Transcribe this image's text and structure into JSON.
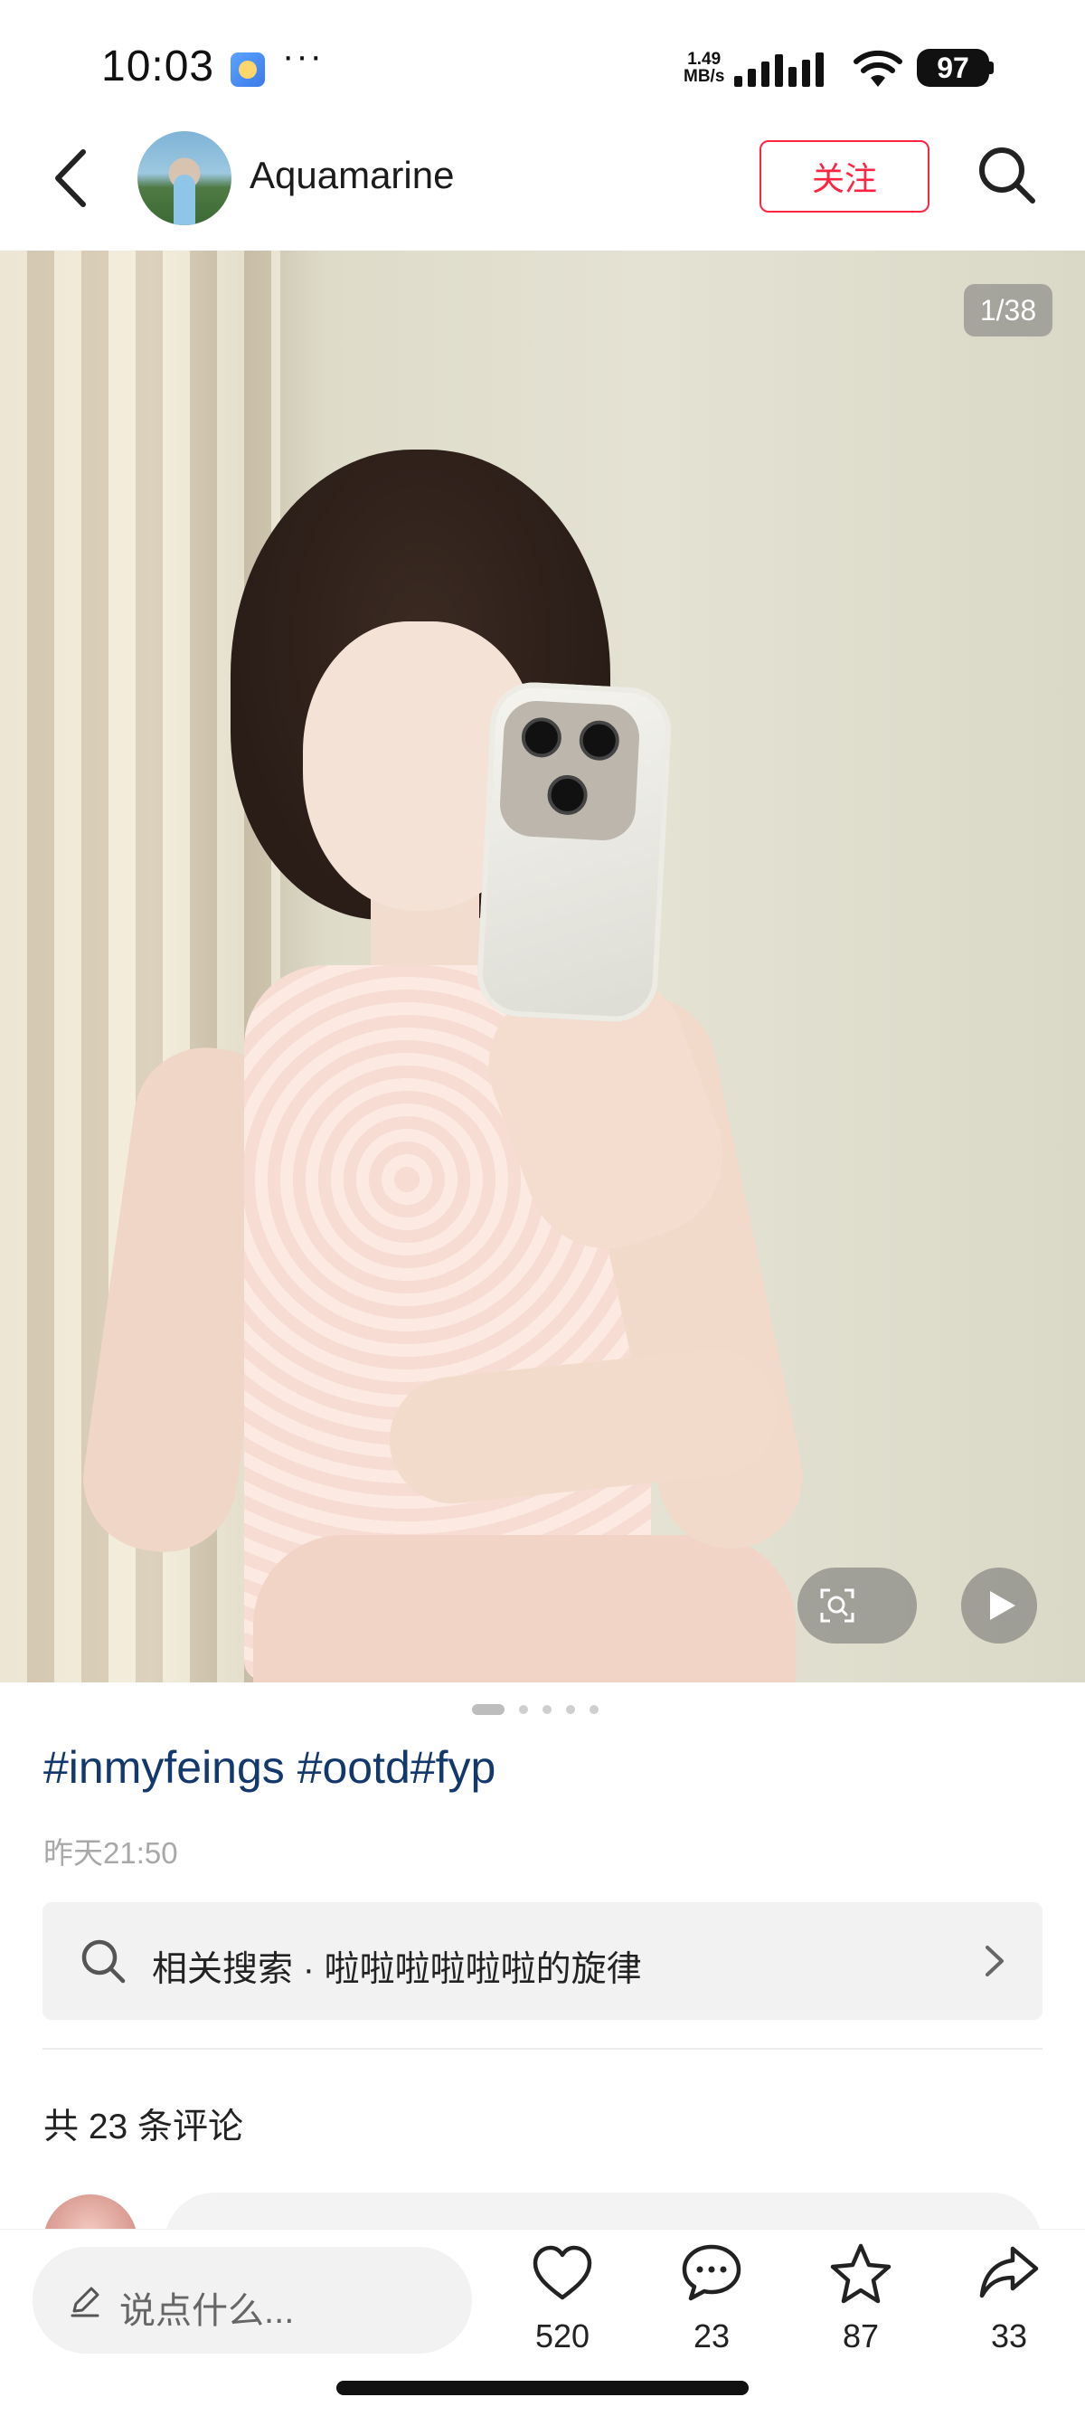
{
  "status_bar": {
    "time": "10:03",
    "dots": "···",
    "net_speed_value": "1.49",
    "net_speed_unit": "MB/s",
    "battery": "97",
    "icons": [
      "app-notification-icon",
      "signal-icon",
      "wifi-icon",
      "battery-icon"
    ]
  },
  "nav": {
    "username": "Aquamarine",
    "follow_label": "关注",
    "icons": [
      "back-icon",
      "search-icon"
    ]
  },
  "media": {
    "counter": "1/38",
    "icons": [
      "image-search-icon",
      "play-icon"
    ],
    "page_dots_total": 5,
    "page_dot_active": 1
  },
  "post": {
    "tags": "#inmyfeings #ootd#fyp",
    "time": "昨天21:50",
    "related_search": "相关搜索 · 啦啦啦啦啦啦的旋律",
    "comment_count_text": "共 23 条评论"
  },
  "bottom_bar": {
    "input_placeholder": "说点什么...",
    "actions": [
      {
        "name": "like",
        "count": "520",
        "icon": "heart-icon"
      },
      {
        "name": "comment",
        "count": "23",
        "icon": "comment-icon"
      },
      {
        "name": "collect",
        "count": "87",
        "icon": "star-icon"
      },
      {
        "name": "share",
        "count": "33",
        "icon": "share-icon"
      }
    ]
  },
  "colors": {
    "accent": "#ff2442",
    "tag": "#13386c"
  }
}
